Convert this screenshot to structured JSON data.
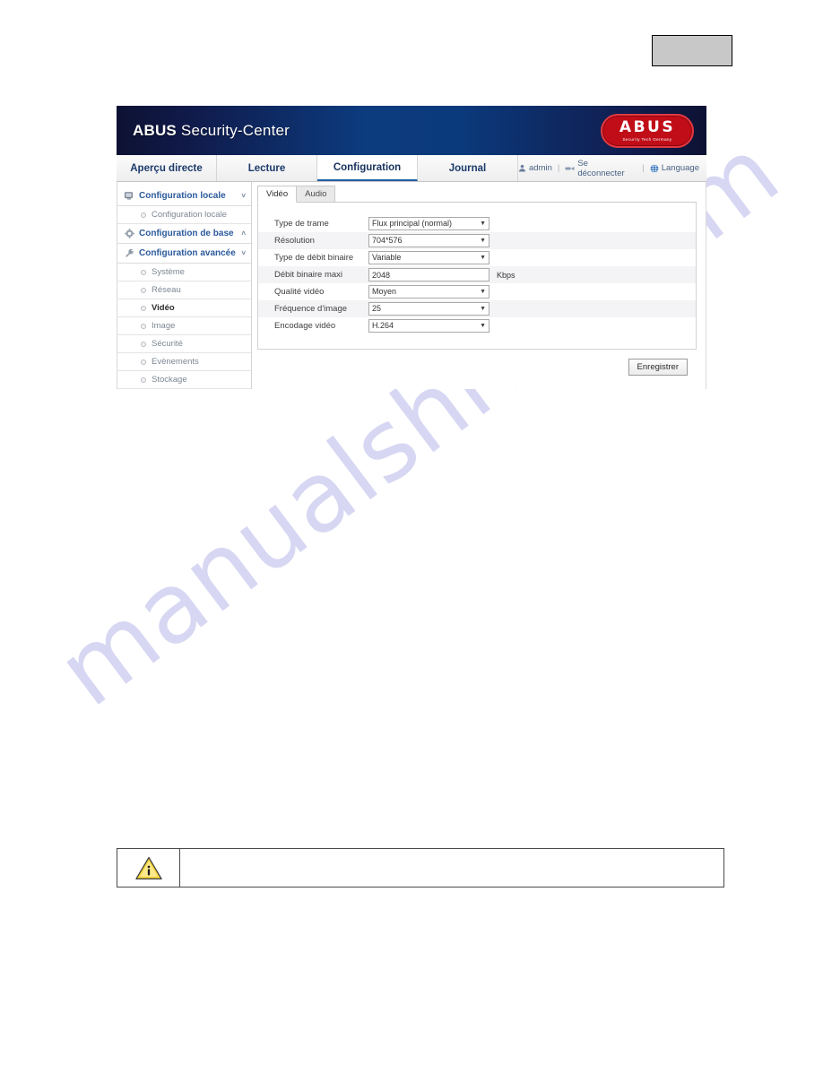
{
  "page": {
    "corner_box_label": ""
  },
  "watermark": {
    "text": "manualshive.com",
    "color": "#c9c9ef"
  },
  "header": {
    "brand_bold": "ABUS",
    "brand_light": " Security-Center",
    "logo": {
      "word": "ABUS",
      "tagline": "Security Tech Germany",
      "color": "#c00d18"
    }
  },
  "nav": {
    "tabs": [
      {
        "label": "Aperçu directe",
        "active": false
      },
      {
        "label": "Lecture",
        "active": false
      },
      {
        "label": "Configuration",
        "active": true
      },
      {
        "label": "Journal",
        "active": false
      }
    ],
    "user": "admin",
    "logout": "Se déconnecter",
    "language": "Language",
    "separator": "|",
    "icons": {
      "user": "user-icon",
      "logout": "logout-icon",
      "language": "globe-icon"
    }
  },
  "sidebar": {
    "groups": [
      {
        "label": "Configuration locale",
        "icon": "monitor-icon",
        "chevron": "˅",
        "items": [
          {
            "label": "Configuration locale",
            "selected": false
          }
        ]
      },
      {
        "label": "Configuration de base",
        "icon": "gear-icon",
        "chevron": "˄",
        "items": []
      },
      {
        "label": "Configuration avancée",
        "icon": "wrench-icon",
        "chevron": "˅",
        "items": [
          {
            "label": "Système",
            "selected": false
          },
          {
            "label": "Réseau",
            "selected": false
          },
          {
            "label": "Vidéo",
            "selected": true
          },
          {
            "label": "Image",
            "selected": false
          },
          {
            "label": "Sécurité",
            "selected": false
          },
          {
            "label": "Evènements",
            "selected": false
          },
          {
            "label": "Stockage",
            "selected": false
          }
        ]
      }
    ]
  },
  "content": {
    "tabs": [
      {
        "label": "Vidéo",
        "active": true
      },
      {
        "label": "Audio",
        "active": false
      }
    ],
    "form": {
      "rows": [
        {
          "label": "Type de trame",
          "type": "select",
          "value": "Flux principal (normal)",
          "unit": ""
        },
        {
          "label": "Résolution",
          "type": "select",
          "value": "704*576",
          "unit": ""
        },
        {
          "label": "Type de débit binaire",
          "type": "select",
          "value": "Variable",
          "unit": ""
        },
        {
          "label": "Débit binaire maxi",
          "type": "text",
          "value": "2048",
          "unit": "Kbps"
        },
        {
          "label": "Qualité vidéo",
          "type": "select",
          "value": "Moyen",
          "unit": ""
        },
        {
          "label": "Fréquence d'image",
          "type": "select",
          "value": "25",
          "unit": ""
        },
        {
          "label": "Encodage vidéo",
          "type": "select",
          "value": "H.264",
          "unit": ""
        }
      ]
    },
    "save_label": "Enregistrer"
  },
  "note": {
    "icon": "warning-info-icon",
    "text": ""
  }
}
